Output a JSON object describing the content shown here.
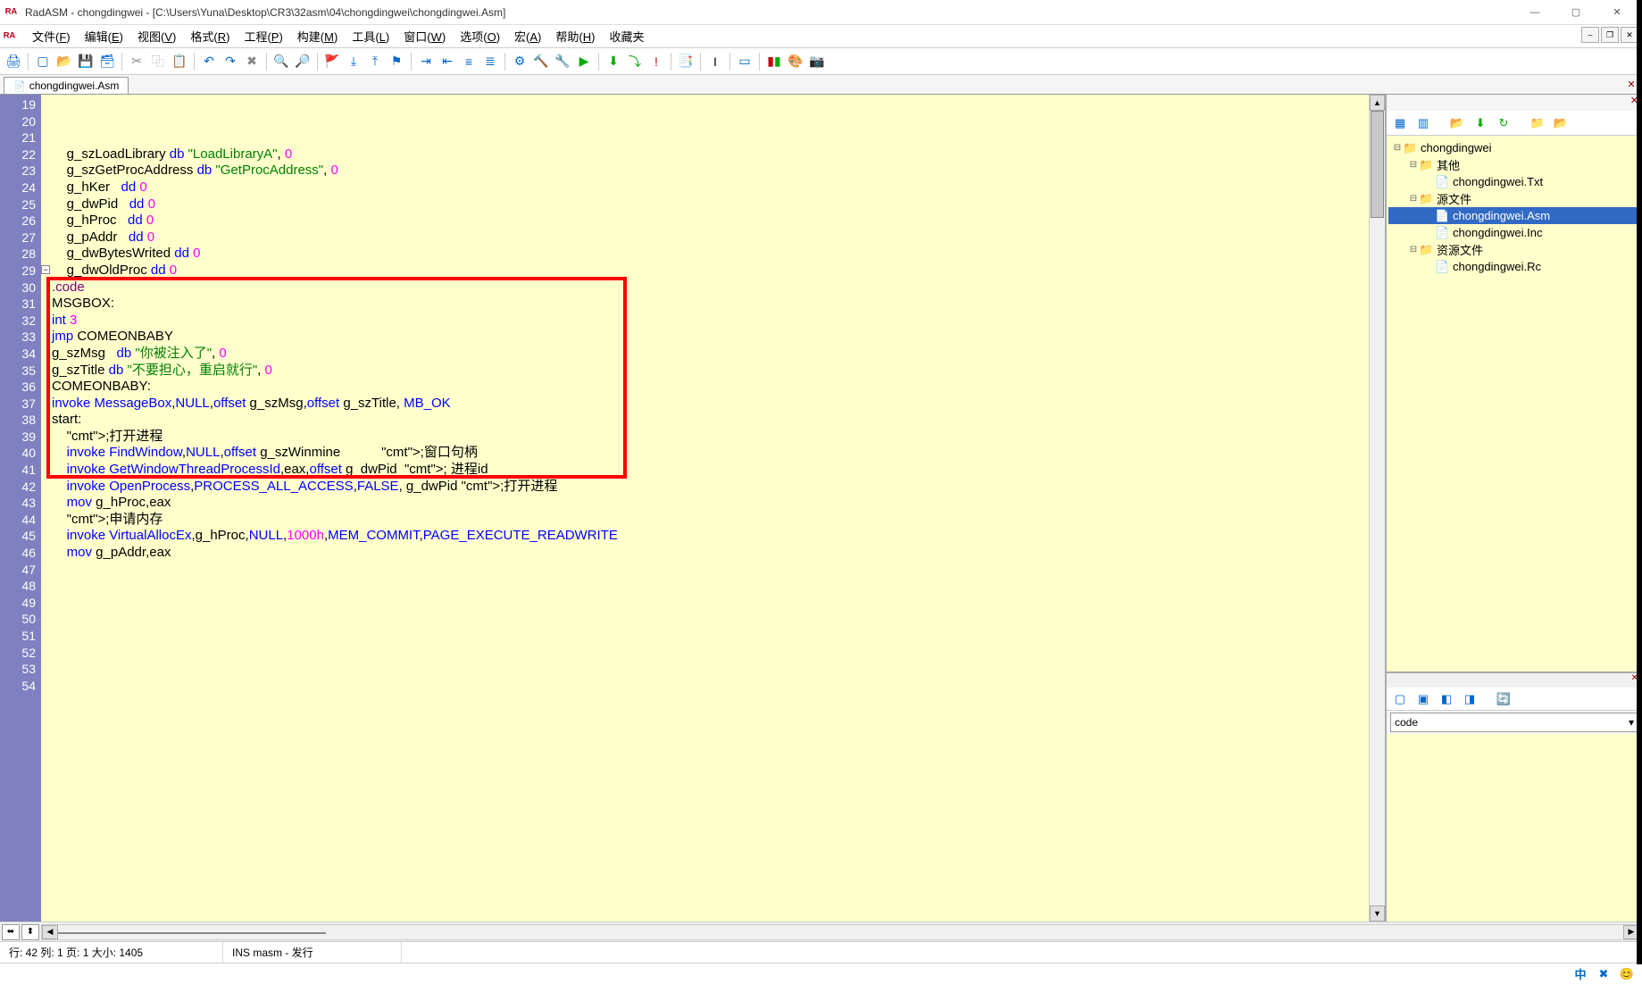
{
  "window": {
    "title": "RadASM - chongdingwei - [C:\\Users\\Yuna\\Desktop\\CR3\\32asm\\04\\chongdingwei\\chongdingwei.Asm]"
  },
  "menubar": {
    "items": [
      {
        "label": "文件",
        "key": "F"
      },
      {
        "label": "编辑",
        "key": "E"
      },
      {
        "label": "视图",
        "key": "V"
      },
      {
        "label": "格式",
        "key": "R"
      },
      {
        "label": "工程",
        "key": "P"
      },
      {
        "label": "构建",
        "key": "M"
      },
      {
        "label": "工具",
        "key": "L"
      },
      {
        "label": "窗口",
        "key": "W"
      },
      {
        "label": "选项",
        "key": "O"
      },
      {
        "label": "宏",
        "key": "A"
      },
      {
        "label": "帮助",
        "key": "H"
      },
      {
        "label": "收藏夹",
        "key": ""
      }
    ]
  },
  "tabs": {
    "active": "chongdingwei.Asm"
  },
  "editor": {
    "first_line_no": 19,
    "last_line_no": 54,
    "lines": [
      {
        "n": 19,
        "raw": "    g_szLoadLibrary db \"LoadLibraryA\", 0"
      },
      {
        "n": 20,
        "raw": "    g_szGetProcAddress db \"GetProcAddress\", 0"
      },
      {
        "n": 21,
        "raw": "    g_hKer   dd 0"
      },
      {
        "n": 22,
        "raw": "    g_dwPid   dd 0"
      },
      {
        "n": 23,
        "raw": "    g_hProc   dd 0"
      },
      {
        "n": 24,
        "raw": "    g_pAddr   dd 0"
      },
      {
        "n": 25,
        "raw": "    g_dwBytesWrited dd 0"
      },
      {
        "n": 26,
        "raw": "    g_dwOldProc dd 0"
      },
      {
        "n": 27,
        "raw": ""
      },
      {
        "n": 28,
        "raw": ""
      },
      {
        "n": 29,
        "raw": ".code"
      },
      {
        "n": 30,
        "raw": ""
      },
      {
        "n": 31,
        "raw": "MSGBOX:"
      },
      {
        "n": 32,
        "raw": "int 3"
      },
      {
        "n": 33,
        "raw": ""
      },
      {
        "n": 34,
        "raw": "jmp COMEONBABY"
      },
      {
        "n": 35,
        "raw": "g_szMsg   db \"你被注入了\", 0"
      },
      {
        "n": 36,
        "raw": "g_szTitle db \"不要担心，重启就行\", 0"
      },
      {
        "n": 37,
        "raw": ""
      },
      {
        "n": 38,
        "raw": "COMEONBABY:"
      },
      {
        "n": 39,
        "raw": "invoke MessageBox,NULL,offset g_szMsg,offset g_szTitle, MB_OK"
      },
      {
        "n": 40,
        "raw": ""
      },
      {
        "n": 41,
        "raw": ""
      },
      {
        "n": 42,
        "raw": ""
      },
      {
        "n": 43,
        "raw": "start:"
      },
      {
        "n": 44,
        "raw": "    ;打开进程"
      },
      {
        "n": 45,
        "raw": "    invoke FindWindow,NULL,offset g_szWinmine           ;窗口句柄"
      },
      {
        "n": 46,
        "raw": "    invoke GetWindowThreadProcessId,eax,offset g_dwPid  ; 进程id"
      },
      {
        "n": 47,
        "raw": "    invoke OpenProcess,PROCESS_ALL_ACCESS,FALSE, g_dwPid ;打开进程"
      },
      {
        "n": 48,
        "raw": "    mov g_hProc,eax"
      },
      {
        "n": 49,
        "raw": ""
      },
      {
        "n": 50,
        "raw": "    ;申请内存"
      },
      {
        "n": 51,
        "raw": "    invoke VirtualAllocEx,g_hProc,NULL,1000h,MEM_COMMIT,PAGE_EXECUTE_READWRITE"
      },
      {
        "n": 52,
        "raw": "    mov g_pAddr,eax"
      },
      {
        "n": 53,
        "raw": ""
      },
      {
        "n": 54,
        "raw": ""
      }
    ]
  },
  "project_tree": {
    "root": "chongdingwei",
    "nodes": [
      {
        "depth": 0,
        "exp": "-",
        "icon": "📁",
        "label": "chongdingwei"
      },
      {
        "depth": 1,
        "exp": "-",
        "icon": "📁",
        "label": "其他"
      },
      {
        "depth": 2,
        "exp": "",
        "icon": "📄",
        "label": "chongdingwei.Txt"
      },
      {
        "depth": 1,
        "exp": "-",
        "icon": "📁",
        "label": "源文件"
      },
      {
        "depth": 2,
        "exp": "",
        "icon": "📄",
        "label": "chongdingwei.Asm",
        "sel": true
      },
      {
        "depth": 2,
        "exp": "",
        "icon": "📄",
        "label": "chongdingwei.Inc"
      },
      {
        "depth": 1,
        "exp": "-",
        "icon": "📁",
        "label": "资源文件"
      },
      {
        "depth": 2,
        "exp": "",
        "icon": "📄",
        "label": "chongdingwei.Rc"
      }
    ]
  },
  "properties": {
    "combo_value": "code"
  },
  "statusbar": {
    "pos": "行: 42  列: 1 页: 1 大小: 1405",
    "mode": "INS masm - 发行"
  },
  "ime": {
    "lang": "中"
  },
  "redbox": {
    "top_line": 30,
    "bottom_line": 41
  }
}
